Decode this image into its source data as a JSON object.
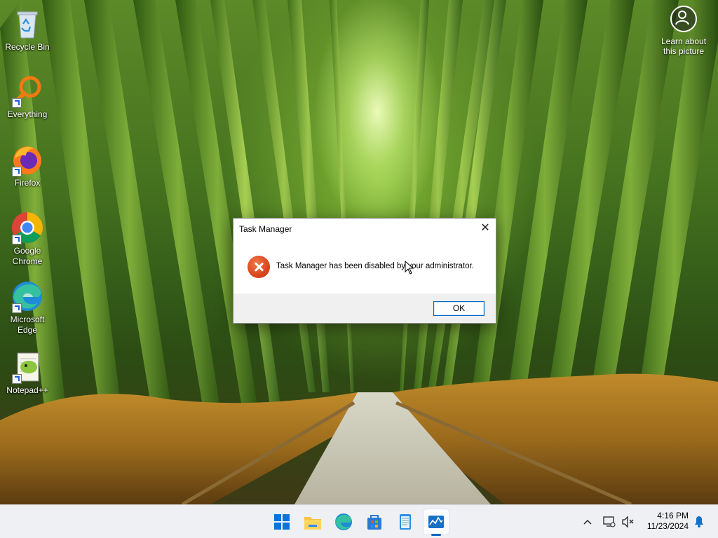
{
  "desktop": {
    "icons": [
      {
        "label": "Recycle Bin"
      },
      {
        "label": "Everything"
      },
      {
        "label": "Firefox"
      },
      {
        "label": "Google Chrome"
      },
      {
        "label": "Microsoft Edge"
      },
      {
        "label": "Notepad++"
      }
    ],
    "spotlight": {
      "label": "Learn about this picture"
    }
  },
  "dialog": {
    "title": "Task Manager",
    "close_glyph": "✕",
    "icon": "error-icon",
    "message": "Task Manager has been disabled by your administrator.",
    "ok_label": "OK"
  },
  "taskbar": {
    "items": [
      {
        "icon": "start-icon"
      },
      {
        "icon": "file-explorer-icon"
      },
      {
        "icon": "edge-icon"
      },
      {
        "icon": "store-icon"
      },
      {
        "icon": "notepad-icon"
      },
      {
        "icon": "task-manager-icon",
        "active": true
      }
    ],
    "tray": {
      "chevron_glyph": "^",
      "time": "4:16 PM",
      "date": "11/23/2024"
    }
  },
  "colors": {
    "accent": "#0067c0",
    "error": "#d9461c",
    "taskbar": "#eef0f3"
  }
}
